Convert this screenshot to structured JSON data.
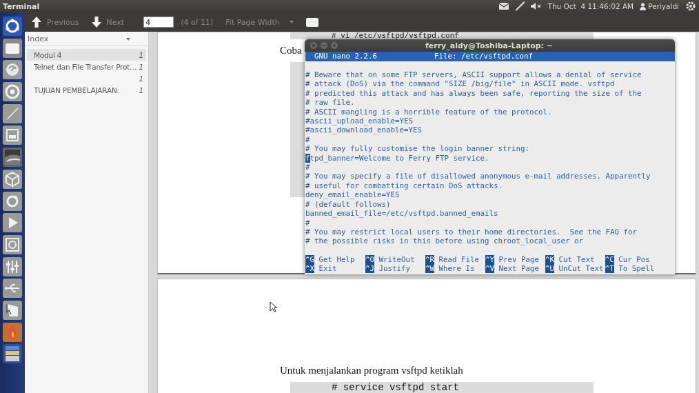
{
  "top_panel": {
    "title": "Terminal",
    "clock": "Thu Oct  4 11:46:02 AM",
    "user": "Periyaldi"
  },
  "toolbar": {
    "previous": "Previous",
    "next": "Next",
    "page_field": "4",
    "page_count": "(4 of 11)",
    "zoom": "Fit Page Width"
  },
  "sidebar": {
    "dropdown": "Index",
    "items": [
      {
        "title": "Modul 4",
        "page": "1",
        "selected": true
      },
      {
        "title": "Telnet dan File Transfer Prot…",
        "page": "1",
        "selected": false
      },
      {
        "page": "1",
        "selected": false
      },
      {
        "title": "TUJUAN PEMBELAJARAN:",
        "page": "1",
        "selected": false
      }
    ]
  },
  "document": {
    "pages": [
      {
        "code": "# vi /etc/vsftpd/vsftpd.conf",
        "text": "Coba"
      },
      {
        "text": "Untuk menjalankan program vsftpd ketiklah",
        "code": "# service vsftpd start"
      }
    ]
  },
  "terminal": {
    "title": "ferry_aldy@Toshiba-Laptop: ~",
    "version": "GNU nano 2.2.6",
    "file": "File: /etc/vsftpd.conf",
    "lines": [
      {
        "text": "# Beware that on some FTP servers, ASCII support allows a denial of service",
        "cursor": false
      },
      {
        "text": "# attack (DoS) via the command \"SIZE /big/file\" in ASCII mode. vsftpd",
        "cursor": false
      },
      {
        "text": "# predicted this attack and has always been safe, reporting the size of the",
        "cursor": false
      },
      {
        "text": "# raw file.",
        "cursor": false
      },
      {
        "text": "# ASCII mangling is a horrible feature of the protocol.",
        "cursor": false
      },
      {
        "text": "#ascii_upload_enable=YES",
        "cursor": false
      },
      {
        "text": "#ascii_download_enable=YES",
        "cursor": false
      },
      {
        "text": "#",
        "cursor": false
      },
      {
        "text": "# You may fully customise the login banner string:",
        "cursor": false
      },
      {
        "text": "ftpd_banner=Welcome to Ferry FTP service.",
        "cursor": true
      },
      {
        "text": "#",
        "cursor": false
      },
      {
        "text": "# You may specify a file of disallowed anonymous e-mail addresses. Apparently",
        "cursor": false
      },
      {
        "text": "# useful for combatting certain DoS attacks.",
        "cursor": false
      },
      {
        "text": "deny_email_enable=YES",
        "cursor": false
      },
      {
        "text": "# (default follows)",
        "cursor": false
      },
      {
        "text": "banned_email_file=/etc/vsftpd.banned_emails",
        "cursor": false
      },
      {
        "text": "#",
        "cursor": false
      },
      {
        "text": "# You may restrict local users to their home directories.  See the FAQ for",
        "cursor": false
      },
      {
        "text": "# the possible risks in this before using chroot_local_user or",
        "cursor": false
      }
    ],
    "shortcuts": [
      {
        "key": "^G",
        "label": "Get Help"
      },
      {
        "key": "^O",
        "label": "WriteOut"
      },
      {
        "key": "^R",
        "label": "Read File"
      },
      {
        "key": "^Y",
        "label": "Prev Page"
      },
      {
        "key": "^K",
        "label": "Cut Text"
      },
      {
        "key": "^C",
        "label": "Cur Pos"
      },
      {
        "key": "^X",
        "label": "Exit"
      },
      {
        "key": "^J",
        "label": "Justify"
      },
      {
        "key": "^W",
        "label": "Where Is"
      },
      {
        "key": "^V",
        "label": "Next Page"
      },
      {
        "key": "^U",
        "label": "UnCut Text"
      },
      {
        "key": "^T",
        "label": "To Spell"
      }
    ]
  }
}
